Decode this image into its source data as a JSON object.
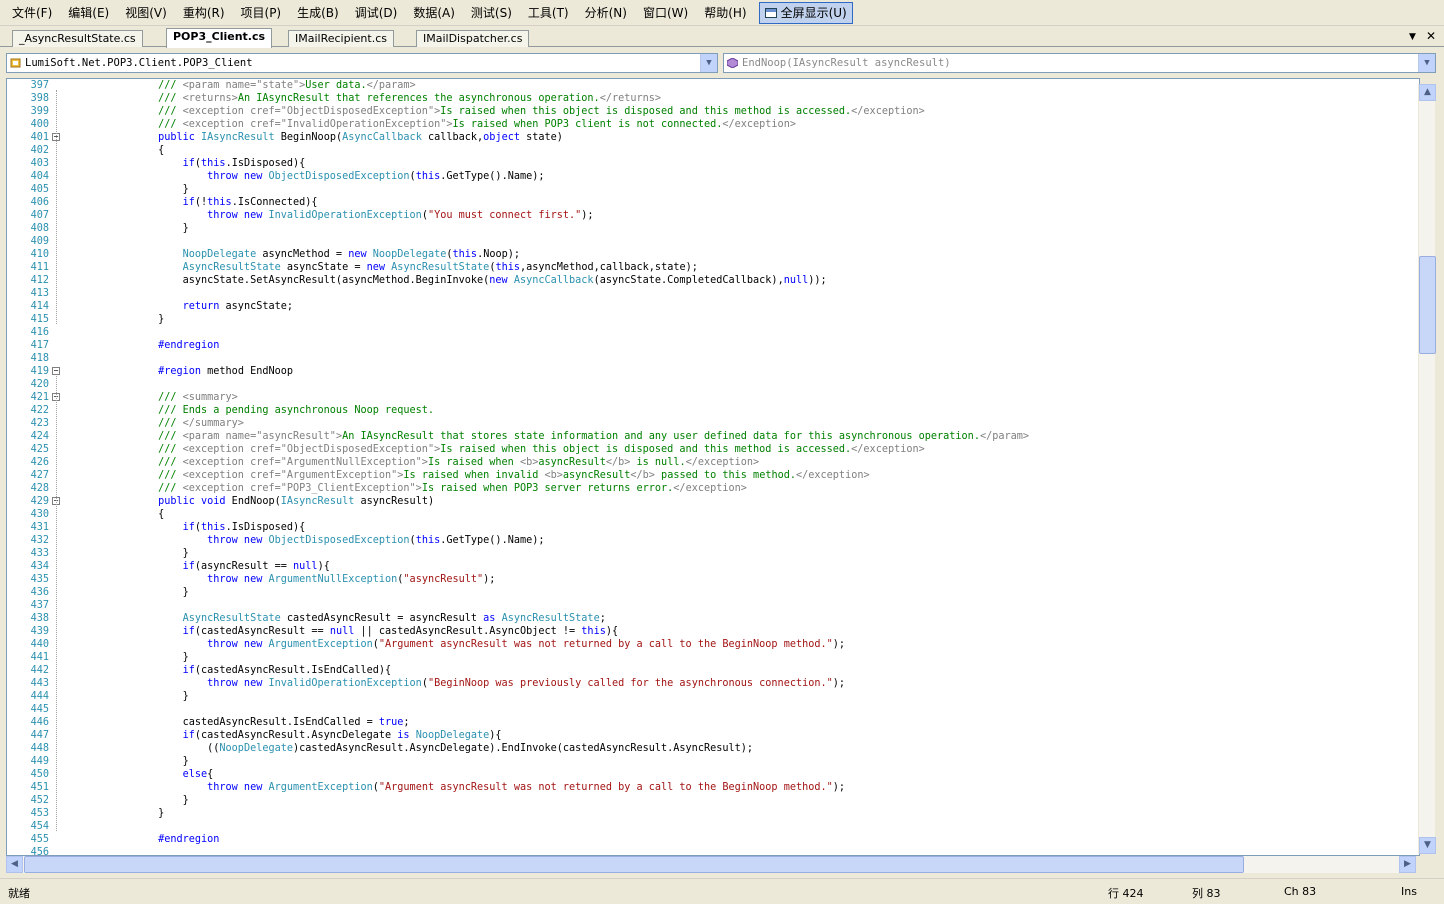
{
  "menu": [
    "文件(F)",
    "编辑(E)",
    "视图(V)",
    "重构(R)",
    "项目(P)",
    "生成(B)",
    "调试(D)",
    "数据(A)",
    "测试(S)",
    "工具(T)",
    "分析(N)",
    "窗口(W)",
    "帮助(H)"
  ],
  "fullscreen_label": "全屏显示(U)",
  "tabs": [
    {
      "label": "_AsyncResultState.cs",
      "active": false
    },
    {
      "label": "POP3_Client.cs",
      "active": true
    },
    {
      "label": "IMailRecipient.cs",
      "active": false
    },
    {
      "label": "IMailDispatcher.cs",
      "active": false
    }
  ],
  "tab_controls": {
    "dropdown": "▼",
    "close": "✕"
  },
  "nav": {
    "type_combo": "LumiSoft.Net.POP3.Client.POP3_Client",
    "member_combo": "EndNoop(IAsyncResult asyncResult)"
  },
  "fold_lines": [
    401,
    419,
    421,
    429
  ],
  "code_lines": [
    {
      "n": "397",
      "t": [
        [
          "cm",
          "        /// "
        ],
        [
          "xd",
          "<param name=\"state\">"
        ],
        [
          "cm",
          "User data."
        ],
        [
          "xd",
          "</param>"
        ]
      ]
    },
    {
      "n": "398",
      "t": [
        [
          "cm",
          "        /// "
        ],
        [
          "xd",
          "<returns>"
        ],
        [
          "cm",
          "An IAsyncResult that references the asynchronous operation."
        ],
        [
          "xd",
          "</returns>"
        ]
      ]
    },
    {
      "n": "399",
      "t": [
        [
          "cm",
          "        /// "
        ],
        [
          "xd",
          "<exception cref=\"ObjectDisposedException\">"
        ],
        [
          "cm",
          "Is raised when this object is disposed and this method is accessed."
        ],
        [
          "xd",
          "</exception>"
        ]
      ]
    },
    {
      "n": "400",
      "t": [
        [
          "cm",
          "        /// "
        ],
        [
          "xd",
          "<exception cref=\"InvalidOperationException\">"
        ],
        [
          "cm",
          "Is raised when POP3 client is not connected."
        ],
        [
          "xd",
          "</exception>"
        ]
      ]
    },
    {
      "n": "401",
      "t": [
        [
          "kw",
          "        public "
        ],
        [
          "ty",
          "IAsyncResult"
        ],
        [
          "p",
          " BeginNoop("
        ],
        [
          "ty",
          "AsyncCallback"
        ],
        [
          "p",
          " callback,"
        ],
        [
          "kw",
          "object"
        ],
        [
          "p",
          " state)"
        ]
      ]
    },
    {
      "n": "402",
      "t": [
        [
          "p",
          "        {"
        ]
      ]
    },
    {
      "n": "403",
      "t": [
        [
          "kw",
          "            if"
        ],
        [
          "p",
          "("
        ],
        [
          "kw",
          "this"
        ],
        [
          "p",
          ".IsDisposed){"
        ]
      ]
    },
    {
      "n": "404",
      "t": [
        [
          "kw",
          "                throw new "
        ],
        [
          "ty",
          "ObjectDisposedException"
        ],
        [
          "p",
          "("
        ],
        [
          "kw",
          "this"
        ],
        [
          "p",
          ".GetType().Name);"
        ]
      ]
    },
    {
      "n": "405",
      "t": [
        [
          "p",
          "            }"
        ]
      ]
    },
    {
      "n": "406",
      "t": [
        [
          "kw",
          "            if"
        ],
        [
          "p",
          "(!"
        ],
        [
          "kw",
          "this"
        ],
        [
          "p",
          ".IsConnected){"
        ]
      ]
    },
    {
      "n": "407",
      "t": [
        [
          "kw",
          "                throw new "
        ],
        [
          "ty",
          "InvalidOperationException"
        ],
        [
          "p",
          "("
        ],
        [
          "str",
          "\"You must connect first.\""
        ],
        [
          "p",
          ");"
        ]
      ]
    },
    {
      "n": "408",
      "t": [
        [
          "p",
          "            }"
        ]
      ]
    },
    {
      "n": "409",
      "t": []
    },
    {
      "n": "410",
      "t": [
        [
          "ty",
          "            NoopDelegate"
        ],
        [
          "p",
          " asyncMethod = "
        ],
        [
          "kw",
          "new "
        ],
        [
          "ty",
          "NoopDelegate"
        ],
        [
          "p",
          "("
        ],
        [
          "kw",
          "this"
        ],
        [
          "p",
          ".Noop);"
        ]
      ]
    },
    {
      "n": "411",
      "t": [
        [
          "ty",
          "            AsyncResultState"
        ],
        [
          "p",
          " asyncState = "
        ],
        [
          "kw",
          "new "
        ],
        [
          "ty",
          "AsyncResultState"
        ],
        [
          "p",
          "("
        ],
        [
          "kw",
          "this"
        ],
        [
          "p",
          ",asyncMethod,callback,state);"
        ]
      ]
    },
    {
      "n": "412",
      "t": [
        [
          "p",
          "            asyncState.SetAsyncResult(asyncMethod.BeginInvoke("
        ],
        [
          "kw",
          "new "
        ],
        [
          "ty",
          "AsyncCallback"
        ],
        [
          "p",
          "(asyncState.CompletedCallback),"
        ],
        [
          "kw",
          "null"
        ],
        [
          "p",
          "));"
        ]
      ]
    },
    {
      "n": "413",
      "t": []
    },
    {
      "n": "414",
      "t": [
        [
          "kw",
          "            return"
        ],
        [
          "p",
          " asyncState;"
        ]
      ]
    },
    {
      "n": "415",
      "t": [
        [
          "p",
          "        }"
        ]
      ]
    },
    {
      "n": "416",
      "t": []
    },
    {
      "n": "417",
      "t": [
        [
          "kw",
          "        #endregion"
        ]
      ]
    },
    {
      "n": "418",
      "t": []
    },
    {
      "n": "419",
      "t": [
        [
          "kw",
          "        #region"
        ],
        [
          "p",
          " method EndNoop"
        ]
      ]
    },
    {
      "n": "420",
      "t": []
    },
    {
      "n": "421",
      "t": [
        [
          "cm",
          "        /// "
        ],
        [
          "xd",
          "<summary>"
        ]
      ]
    },
    {
      "n": "422",
      "t": [
        [
          "cm",
          "        /// Ends a pending asynchronous Noop request."
        ]
      ]
    },
    {
      "n": "423",
      "t": [
        [
          "cm",
          "        /// "
        ],
        [
          "xd",
          "</summary>"
        ]
      ]
    },
    {
      "n": "424",
      "t": [
        [
          "cm",
          "        /// "
        ],
        [
          "xd",
          "<param name=\"asyncResult\">"
        ],
        [
          "cm",
          "An IAsyncResult that stores state information and any user defined data for this asynchronous operation."
        ],
        [
          "xd",
          "</param>"
        ]
      ]
    },
    {
      "n": "425",
      "t": [
        [
          "cm",
          "        /// "
        ],
        [
          "xd",
          "<exception cref=\"ObjectDisposedException\">"
        ],
        [
          "cm",
          "Is raised when this object is disposed and this method is accessed."
        ],
        [
          "xd",
          "</exception>"
        ]
      ]
    },
    {
      "n": "426",
      "t": [
        [
          "cm",
          "        /// "
        ],
        [
          "xd",
          "<exception cref=\"ArgumentNullException\">"
        ],
        [
          "cm",
          "Is raised when "
        ],
        [
          "xd",
          "<b>"
        ],
        [
          "cm",
          "asyncResult"
        ],
        [
          "xd",
          "</b>"
        ],
        [
          "cm",
          " is null."
        ],
        [
          "xd",
          "</exception>"
        ]
      ]
    },
    {
      "n": "427",
      "t": [
        [
          "cm",
          "        /// "
        ],
        [
          "xd",
          "<exception cref=\"ArgumentException\">"
        ],
        [
          "cm",
          "Is raised when invalid "
        ],
        [
          "xd",
          "<b>"
        ],
        [
          "cm",
          "asyncResult"
        ],
        [
          "xd",
          "</b>"
        ],
        [
          "cm",
          " passed to this method."
        ],
        [
          "xd",
          "</exception>"
        ]
      ]
    },
    {
      "n": "428",
      "t": [
        [
          "cm",
          "        /// "
        ],
        [
          "xd",
          "<exception cref=\"POP3_ClientException\">"
        ],
        [
          "cm",
          "Is raised when POP3 server returns error."
        ],
        [
          "xd",
          "</exception>"
        ]
      ]
    },
    {
      "n": "429",
      "t": [
        [
          "kw",
          "        public void"
        ],
        [
          "p",
          " EndNoop("
        ],
        [
          "ty",
          "IAsyncResult"
        ],
        [
          "p",
          " asyncResult)"
        ]
      ]
    },
    {
      "n": "430",
      "t": [
        [
          "p",
          "        {"
        ]
      ]
    },
    {
      "n": "431",
      "t": [
        [
          "kw",
          "            if"
        ],
        [
          "p",
          "("
        ],
        [
          "kw",
          "this"
        ],
        [
          "p",
          ".IsDisposed){"
        ]
      ]
    },
    {
      "n": "432",
      "t": [
        [
          "kw",
          "                throw new "
        ],
        [
          "ty",
          "ObjectDisposedException"
        ],
        [
          "p",
          "("
        ],
        [
          "kw",
          "this"
        ],
        [
          "p",
          ".GetType().Name);"
        ]
      ]
    },
    {
      "n": "433",
      "t": [
        [
          "p",
          "            }"
        ]
      ]
    },
    {
      "n": "434",
      "t": [
        [
          "kw",
          "            if"
        ],
        [
          "p",
          "(asyncResult == "
        ],
        [
          "kw",
          "null"
        ],
        [
          "p",
          "){"
        ]
      ]
    },
    {
      "n": "435",
      "t": [
        [
          "kw",
          "                throw new "
        ],
        [
          "ty",
          "ArgumentNullException"
        ],
        [
          "p",
          "("
        ],
        [
          "str",
          "\"asyncResult\""
        ],
        [
          "p",
          ");"
        ]
      ]
    },
    {
      "n": "436",
      "t": [
        [
          "p",
          "            }"
        ]
      ]
    },
    {
      "n": "437",
      "t": []
    },
    {
      "n": "438",
      "t": [
        [
          "ty",
          "            AsyncResultState"
        ],
        [
          "p",
          " castedAsyncResult = asyncResult "
        ],
        [
          "kw",
          "as "
        ],
        [
          "ty",
          "AsyncResultState"
        ],
        [
          "p",
          ";"
        ]
      ]
    },
    {
      "n": "439",
      "t": [
        [
          "kw",
          "            if"
        ],
        [
          "p",
          "(castedAsyncResult == "
        ],
        [
          "kw",
          "null"
        ],
        [
          "p",
          " || castedAsyncResult.AsyncObject != "
        ],
        [
          "kw",
          "this"
        ],
        [
          "p",
          "){"
        ]
      ]
    },
    {
      "n": "440",
      "t": [
        [
          "kw",
          "                throw new "
        ],
        [
          "ty",
          "ArgumentException"
        ],
        [
          "p",
          "("
        ],
        [
          "str",
          "\"Argument asyncResult was not returned by a call to the BeginNoop method.\""
        ],
        [
          "p",
          ");"
        ]
      ]
    },
    {
      "n": "441",
      "t": [
        [
          "p",
          "            }"
        ]
      ]
    },
    {
      "n": "442",
      "t": [
        [
          "kw",
          "            if"
        ],
        [
          "p",
          "(castedAsyncResult.IsEndCalled){"
        ]
      ]
    },
    {
      "n": "443",
      "t": [
        [
          "kw",
          "                throw new "
        ],
        [
          "ty",
          "InvalidOperationException"
        ],
        [
          "p",
          "("
        ],
        [
          "str",
          "\"BeginNoop was previously called for the asynchronous connection.\""
        ],
        [
          "p",
          ");"
        ]
      ]
    },
    {
      "n": "444",
      "t": [
        [
          "p",
          "            }"
        ]
      ]
    },
    {
      "n": "445",
      "t": []
    },
    {
      "n": "446",
      "t": [
        [
          "p",
          "            castedAsyncResult.IsEndCalled = "
        ],
        [
          "kw",
          "true"
        ],
        [
          "p",
          ";"
        ]
      ]
    },
    {
      "n": "447",
      "t": [
        [
          "kw",
          "            if"
        ],
        [
          "p",
          "(castedAsyncResult.AsyncDelegate "
        ],
        [
          "kw",
          "is "
        ],
        [
          "ty",
          "NoopDelegate"
        ],
        [
          "p",
          "){"
        ]
      ]
    },
    {
      "n": "448",
      "t": [
        [
          "p",
          "                (("
        ],
        [
          "ty",
          "NoopDelegate"
        ],
        [
          "p",
          ")castedAsyncResult.AsyncDelegate).EndInvoke(castedAsyncResult.AsyncResult);"
        ]
      ]
    },
    {
      "n": "449",
      "t": [
        [
          "p",
          "            }"
        ]
      ]
    },
    {
      "n": "450",
      "t": [
        [
          "kw",
          "            else"
        ],
        [
          "p",
          "{"
        ]
      ]
    },
    {
      "n": "451",
      "t": [
        [
          "kw",
          "                throw new "
        ],
        [
          "ty",
          "ArgumentException"
        ],
        [
          "p",
          "("
        ],
        [
          "str",
          "\"Argument asyncResult was not returned by a call to the BeginNoop method.\""
        ],
        [
          "p",
          ");"
        ]
      ]
    },
    {
      "n": "452",
      "t": [
        [
          "p",
          "            }"
        ]
      ]
    },
    {
      "n": "453",
      "t": [
        [
          "p",
          "        }"
        ]
      ]
    },
    {
      "n": "454",
      "t": []
    },
    {
      "n": "455",
      "t": [
        [
          "kw",
          "        #endregion"
        ]
      ]
    },
    {
      "n": "456",
      "t": []
    }
  ],
  "status": {
    "ready": "就绪",
    "line": "行 424",
    "col": "列 83",
    "ch": "Ch 83",
    "mode": "Ins"
  },
  "colors": {
    "keyword": "#0000ff",
    "type": "#2b91af",
    "string": "#a31515",
    "comment": "#008000",
    "xmldoc": "#808080"
  }
}
